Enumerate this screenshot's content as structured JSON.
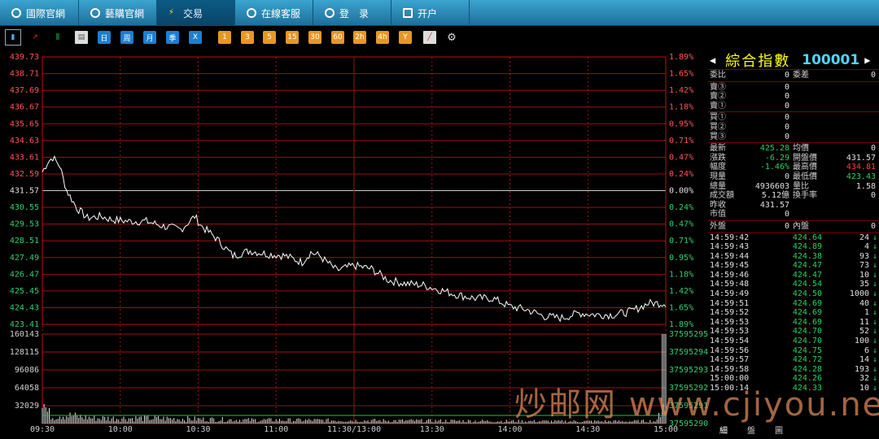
{
  "nav": [
    {
      "label": "國際官網",
      "icon": "globe-icon"
    },
    {
      "label": "藝購官網",
      "icon": "link-icon"
    },
    {
      "label": "交易",
      "icon": "lightning-icon"
    },
    {
      "label": "在線客服",
      "icon": "chat-icon"
    },
    {
      "label": "登　录",
      "icon": "person-icon"
    },
    {
      "label": "开户",
      "icon": "monitor-icon"
    }
  ],
  "toolbar": {
    "periods": [
      "日",
      "周",
      "月",
      "季",
      "X"
    ],
    "minutes": [
      "1",
      "3",
      "5",
      "15",
      "30",
      "60",
      "2h",
      "4h",
      "Y"
    ]
  },
  "chart_data": {
    "type": "line",
    "title": "綜合指數",
    "price_axis": [
      "439.73",
      "438.71",
      "437.69",
      "436.67",
      "435.65",
      "434.63",
      "433.61",
      "432.59",
      "431.57",
      "430.55",
      "429.53",
      "428.51",
      "427.49",
      "426.47",
      "425.45",
      "424.43",
      "423.41"
    ],
    "pct_axis": [
      "1.89%",
      "1.65%",
      "1.42%",
      "1.18%",
      "0.95%",
      "0.71%",
      "0.47%",
      "0.24%",
      "0.00%",
      "0.24%",
      "0.47%",
      "0.71%",
      "0.95%",
      "1.18%",
      "1.42%",
      "1.65%",
      "1.89%"
    ],
    "ylim": [
      423.41,
      439.73
    ],
    "prev_close": 431.57,
    "x_labels": [
      "09:30",
      "10:00",
      "10:30",
      "11:00",
      "11:30/13:00",
      "13:30",
      "14:00",
      "14:30",
      "15:00"
    ],
    "volume_axis": [
      "160143",
      "128115",
      "96086",
      "64058",
      "32029"
    ],
    "volume_right_axis": [
      "37595295",
      "37595294",
      "37595293",
      "37595292",
      "37595291",
      "37595290"
    ],
    "price_keypoints": [
      [
        0,
        432.7
      ],
      [
        3,
        433.3
      ],
      [
        6,
        433.6
      ],
      [
        10,
        433.1
      ],
      [
        14,
        431.6
      ],
      [
        20,
        430.5
      ],
      [
        26,
        429.9
      ],
      [
        34,
        430.0
      ],
      [
        40,
        429.8
      ],
      [
        50,
        429.7
      ],
      [
        60,
        429.7
      ],
      [
        70,
        429.4
      ],
      [
        80,
        429.2
      ],
      [
        88,
        430.0
      ],
      [
        92,
        429.4
      ],
      [
        100,
        428.7
      ],
      [
        110,
        427.6
      ],
      [
        120,
        427.9
      ],
      [
        130,
        427.7
      ],
      [
        140,
        427.6
      ],
      [
        150,
        427.2
      ],
      [
        155,
        427.8
      ],
      [
        160,
        427.6
      ],
      [
        170,
        426.7
      ],
      [
        180,
        427.0
      ],
      [
        190,
        426.8
      ],
      [
        200,
        426.1
      ],
      [
        210,
        425.9
      ],
      [
        220,
        425.8
      ],
      [
        230,
        425.5
      ],
      [
        240,
        425.2
      ],
      [
        250,
        425.0
      ],
      [
        260,
        425.0
      ],
      [
        270,
        424.5
      ],
      [
        280,
        424.3
      ],
      [
        290,
        423.9
      ],
      [
        300,
        423.8
      ],
      [
        310,
        424.1
      ],
      [
        320,
        424.0
      ],
      [
        330,
        424.0
      ],
      [
        340,
        424.2
      ],
      [
        350,
        424.7
      ]
    ],
    "volume_keypoints": [
      [
        0,
        50000
      ],
      [
        1,
        44000
      ],
      [
        3,
        26000
      ],
      [
        6,
        15000
      ],
      [
        10,
        20000
      ],
      [
        30,
        12000
      ],
      [
        60,
        12000
      ],
      [
        120,
        8000
      ],
      [
        180,
        7000
      ],
      [
        240,
        6000
      ],
      [
        300,
        5000
      ],
      [
        340,
        5000
      ],
      [
        355,
        6000
      ],
      [
        357,
        30000
      ],
      [
        359,
        160143
      ],
      [
        360,
        160143
      ]
    ]
  },
  "panel": {
    "name": "綜合指數",
    "code": "100001",
    "weibi": {
      "label": "委比",
      "value": "0"
    },
    "weicha": {
      "label": "委差",
      "value": "0"
    },
    "sell": [
      {
        "label": "賣③",
        "price": "0",
        "vol": ""
      },
      {
        "label": "賣②",
        "price": "0",
        "vol": ""
      },
      {
        "label": "賣①",
        "price": "0",
        "vol": ""
      }
    ],
    "buy": [
      {
        "label": "買①",
        "price": "0",
        "vol": ""
      },
      {
        "label": "買②",
        "price": "0",
        "vol": ""
      },
      {
        "label": "買③",
        "price": "0",
        "vol": ""
      }
    ],
    "stats": [
      [
        {
          "l": "最新",
          "v": "425.28",
          "c": "green"
        },
        {
          "l": "均價",
          "v": "0",
          "c": "white"
        }
      ],
      [
        {
          "l": "漲跌",
          "v": "-6.29",
          "c": "green"
        },
        {
          "l": "開盤價",
          "v": "431.57",
          "c": "white"
        }
      ],
      [
        {
          "l": "幅度",
          "v": "-1.46%",
          "c": "green"
        },
        {
          "l": "最高價",
          "v": "434.81",
          "c": "red"
        }
      ],
      [
        {
          "l": "現量",
          "v": "0",
          "c": "white"
        },
        {
          "l": "最低價",
          "v": "423.43",
          "c": "green"
        }
      ],
      [
        {
          "l": "總量",
          "v": "4936603",
          "c": "white"
        },
        {
          "l": "量比",
          "v": "1.58",
          "c": "white"
        }
      ],
      [
        {
          "l": "成交額",
          "v": "5.12億",
          "c": "white"
        },
        {
          "l": "換手率",
          "v": "0",
          "c": "white"
        }
      ],
      [
        {
          "l": "昨收",
          "v": "431.57",
          "c": "white"
        },
        {
          "l": "",
          "v": "",
          "c": "white"
        }
      ],
      [
        {
          "l": "市值",
          "v": "0",
          "c": "white"
        },
        {
          "l": "",
          "v": "",
          "c": "white"
        }
      ]
    ],
    "waipan": {
      "label": "外盤",
      "value": "0"
    },
    "neipan": {
      "label": "內盤",
      "value": "0"
    },
    "ticks": [
      {
        "t": "14:59:42",
        "p": "424.64",
        "v": "24"
      },
      {
        "t": "14:59:43",
        "p": "424.89",
        "v": "4"
      },
      {
        "t": "14:59:44",
        "p": "424.38",
        "v": "93"
      },
      {
        "t": "14:59:45",
        "p": "424.47",
        "v": "73"
      },
      {
        "t": "14:59:46",
        "p": "424.47",
        "v": "10"
      },
      {
        "t": "14:59:48",
        "p": "424.54",
        "v": "35"
      },
      {
        "t": "14:59:49",
        "p": "424.50",
        "v": "1000"
      },
      {
        "t": "14:59:51",
        "p": "424.69",
        "v": "40"
      },
      {
        "t": "14:59:52",
        "p": "424.69",
        "v": "1"
      },
      {
        "t": "14:59:53",
        "p": "424.69",
        "v": "11"
      },
      {
        "t": "14:59:53",
        "p": "424.70",
        "v": "52"
      },
      {
        "t": "14:59:54",
        "p": "424.70",
        "v": "100"
      },
      {
        "t": "14:59:56",
        "p": "424.75",
        "v": "6"
      },
      {
        "t": "14:59:57",
        "p": "424.72",
        "v": "14"
      },
      {
        "t": "14:59:58",
        "p": "424.28",
        "v": "193"
      },
      {
        "t": "15:00:00",
        "p": "424.26",
        "v": "32"
      },
      {
        "t": "15:00:14",
        "p": "424.33",
        "v": "10"
      }
    ],
    "tabs": [
      "細",
      "盤",
      "圖"
    ]
  },
  "watermark": "炒邮网 www.cjiyou.net"
}
